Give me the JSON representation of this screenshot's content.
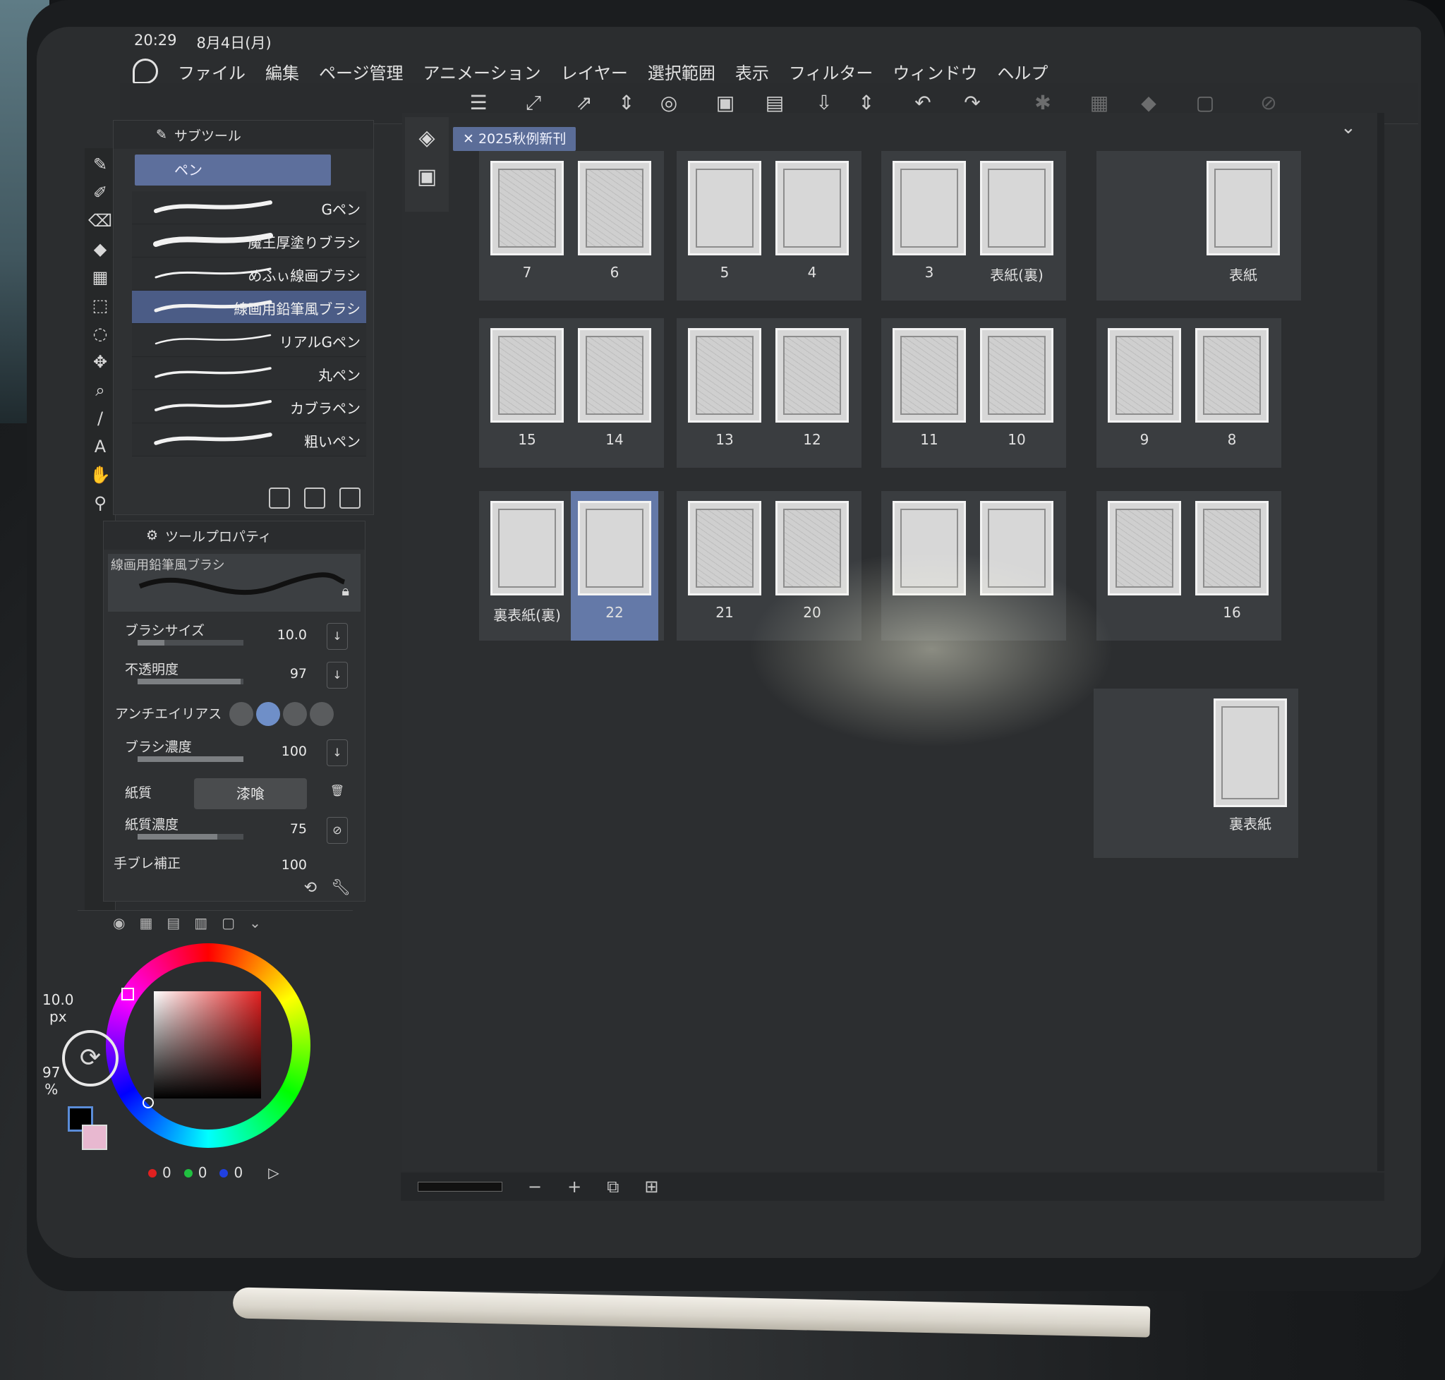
{
  "status": {
    "time": "20:29",
    "date": "8月4日(月)"
  },
  "menu": [
    "ファイル",
    "編集",
    "ページ管理",
    "アニメーション",
    "レイヤー",
    "選択範囲",
    "表示",
    "フィルター",
    "ウィンドウ",
    "ヘルプ"
  ],
  "subtool": {
    "tab_label": "サブツール",
    "group_label": "ペン",
    "brushes": [
      {
        "name": "Gペン",
        "selected": false
      },
      {
        "name": "魔王厚塗りブラシ",
        "selected": false
      },
      {
        "name": "めふぃ線画ブラシ",
        "selected": false
      },
      {
        "name": "線画用鉛筆風ブラシ",
        "selected": true
      },
      {
        "name": "リアルGペン",
        "selected": false
      },
      {
        "name": "丸ペン",
        "selected": false
      },
      {
        "name": "カブラペン",
        "selected": false
      },
      {
        "name": "粗いペン",
        "selected": false
      }
    ]
  },
  "tool_property": {
    "tab_label": "ツールプロパティ",
    "preview_label": "線画用鉛筆風ブラシ",
    "brush_size": {
      "label": "ブラシサイズ",
      "value": "10.0",
      "fraction": 0.25
    },
    "opacity": {
      "label": "不透明度",
      "value": "97",
      "fraction": 0.97
    },
    "antialias": {
      "label": "アンチエイリアス"
    },
    "brush_density": {
      "label": "ブラシ濃度",
      "value": "100",
      "fraction": 1.0
    },
    "paper": {
      "label": "紙質",
      "value": "漆喰"
    },
    "paper_density": {
      "label": "紙質濃度",
      "value": "75",
      "fraction": 0.75
    },
    "stabilization": {
      "label": "手ブレ補正",
      "value": "100"
    }
  },
  "color": {
    "r": "0",
    "g": "0",
    "b": "0",
    "accent": "#e32020"
  },
  "side_readouts": {
    "size": "10.0",
    "size_unit": "px",
    "opacity": "97",
    "opacity_unit": "%"
  },
  "document_tab": "2025秋例新刊",
  "pages": {
    "row1": [
      [
        "7",
        "6"
      ],
      [
        "5",
        "4"
      ],
      [
        "3",
        "表紙(裏)"
      ],
      [
        "表紙"
      ]
    ],
    "row2": [
      [
        "15",
        "14"
      ],
      [
        "13",
        "12"
      ],
      [
        "11",
        "10"
      ],
      [
        "9",
        "8"
      ]
    ],
    "row3": [
      [
        "裏表紙(裏)",
        "22"
      ],
      [
        "21",
        "20"
      ],
      [
        "",
        ""
      ],
      [
        "",
        "16"
      ]
    ],
    "row4": [
      [
        "裏表紙"
      ]
    ],
    "selected_page": "22"
  },
  "bottom_bar": {
    "minus": "−",
    "plus": "+"
  }
}
